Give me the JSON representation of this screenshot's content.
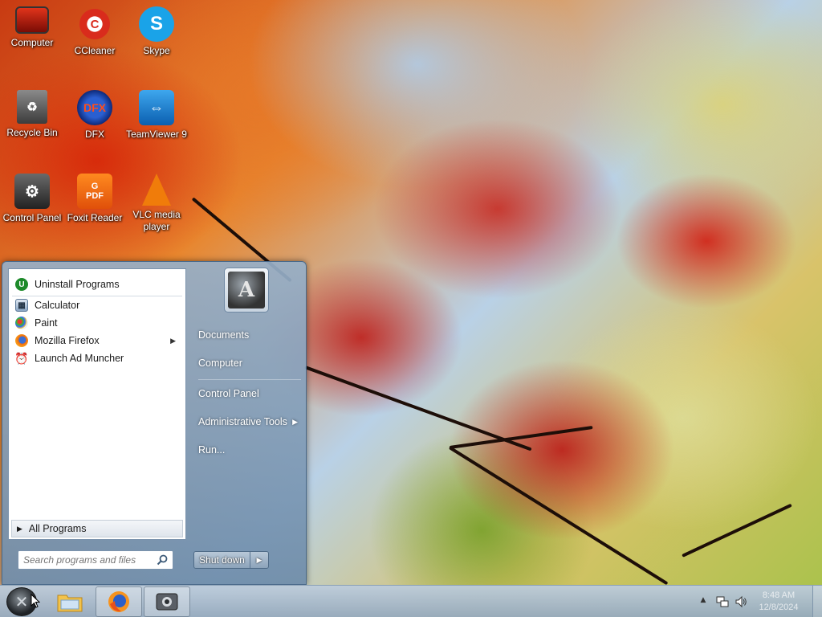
{
  "desktop": {
    "icons": [
      {
        "label": "Computer",
        "icon": "monitor-icon"
      },
      {
        "label": "CCleaner",
        "icon": "ccleaner-icon"
      },
      {
        "label": "Skype",
        "icon": "skype-icon"
      },
      {
        "label": "Recycle Bin",
        "icon": "recycle-bin-icon"
      },
      {
        "label": "DFX",
        "icon": "dfx-icon"
      },
      {
        "label": "TeamViewer 9",
        "icon": "teamviewer-icon"
      },
      {
        "label": "Control Panel",
        "icon": "control-panel-icon"
      },
      {
        "label": "Foxit Reader",
        "icon": "foxit-reader-icon"
      },
      {
        "label": "VLC media player",
        "icon": "vlc-icon"
      }
    ]
  },
  "start_menu": {
    "programs": [
      {
        "label": "Uninstall Programs",
        "icon": "uninstall-icon"
      },
      {
        "label": "Calculator",
        "icon": "calculator-icon"
      },
      {
        "label": "Paint",
        "icon": "paint-icon"
      },
      {
        "label": "Mozilla Firefox",
        "icon": "firefox-icon"
      },
      {
        "label": "Launch Ad Muncher",
        "icon": "ad-muncher-icon"
      }
    ],
    "all_programs": "All Programs",
    "search_placeholder": "Search programs and files",
    "right_items": [
      "Documents",
      "Computer",
      "Control Panel",
      "Administrative Tools",
      "Run..."
    ],
    "shutdown_label": "Shut down"
  },
  "taskbar": {
    "apps": [
      "file-explorer-icon",
      "firefox-icon",
      "app-icon"
    ],
    "clock_time": "8:48 AM",
    "clock_date": "12/8/2024"
  },
  "colors": {
    "start_menu": "#8ca3ba",
    "taskbar": "#a9bccf"
  }
}
